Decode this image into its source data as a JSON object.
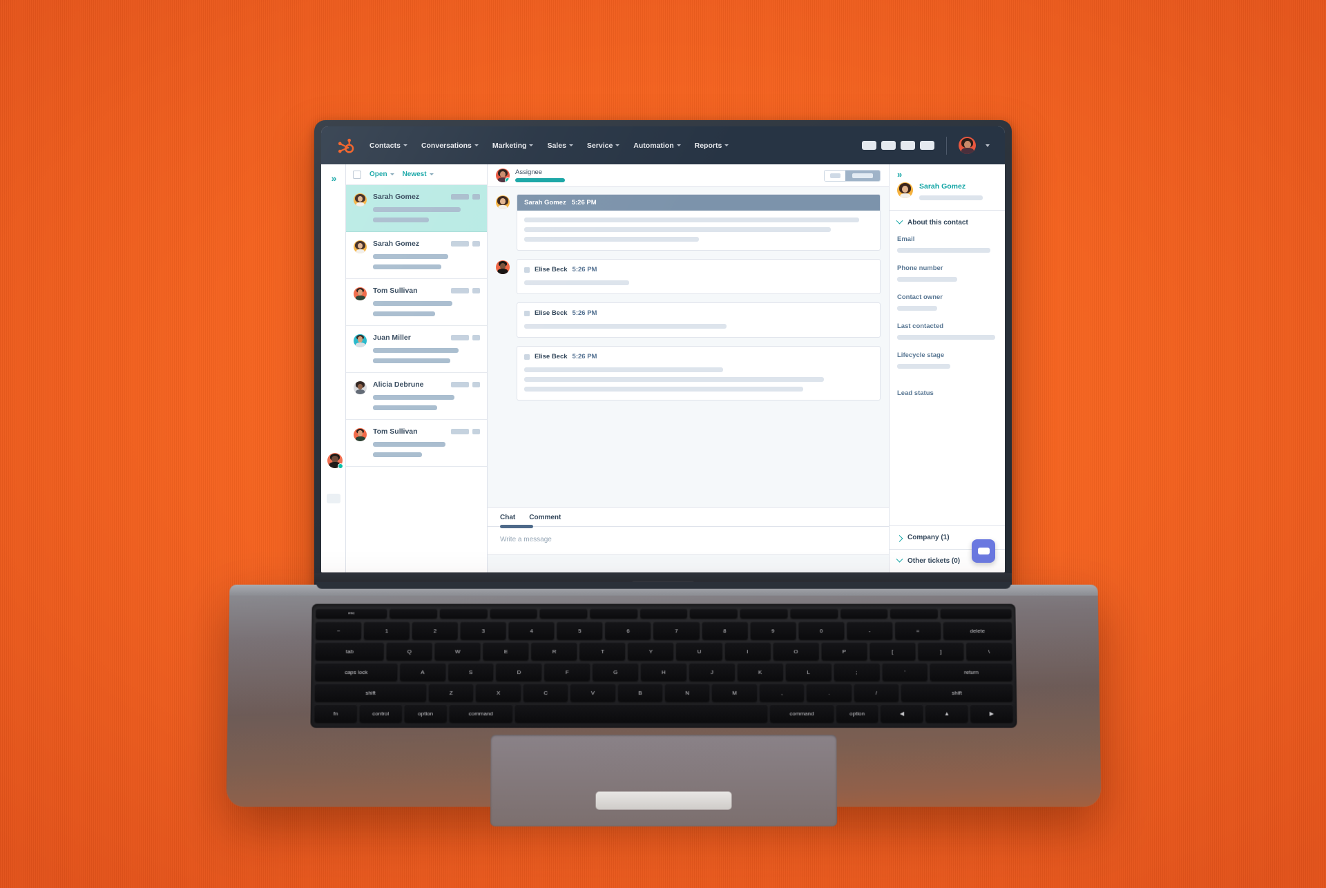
{
  "brand": {
    "logo_icon": "hubspot-sprocket-icon",
    "orange": "#f4621f",
    "navy": "#273444",
    "teal": "#0fa4a4",
    "accent_purple": "#6a78e0"
  },
  "topnav": {
    "items": [
      {
        "label": "Contacts",
        "caret": true
      },
      {
        "label": "Conversations",
        "caret": true
      },
      {
        "label": "Marketing",
        "caret": true
      },
      {
        "label": "Sales",
        "caret": true
      },
      {
        "label": "Service",
        "caret": true
      },
      {
        "label": "Automation",
        "caret": true
      },
      {
        "label": "Reports",
        "caret": true
      }
    ],
    "right_pills": 4,
    "avatar_icon": "user-avatar",
    "caret_icon": "chevron-down-icon"
  },
  "rail": {
    "expand_icon": "»",
    "avatar_icon": "user-avatar",
    "status": "online"
  },
  "list": {
    "checkbox_checked": false,
    "filters": [
      {
        "label": "Open"
      },
      {
        "label": "Newest"
      }
    ],
    "conversations": [
      {
        "name": "Sarah Gomez",
        "active": true
      },
      {
        "name": "Sarah Gomez",
        "active": false
      },
      {
        "name": "Tom Sullivan",
        "active": false
      },
      {
        "name": "Juan Miller",
        "active": false
      },
      {
        "name": "Alicia Debrune",
        "active": false
      },
      {
        "name": "Tom Sullivan",
        "active": false
      }
    ]
  },
  "thread": {
    "assignee_label": "Assignee",
    "messages": [
      {
        "author": "Sarah Gomez",
        "time": "5:26 PM",
        "style": "highlighted",
        "lines": 3
      },
      {
        "author": "Elise Beck",
        "time": "5:26 PM",
        "style": "plain",
        "lines": 1
      },
      {
        "author": "Elise Beck",
        "time": "5:26 PM",
        "style": "plain",
        "lines": 1
      },
      {
        "author": "Elise Beck",
        "time": "5:26 PM",
        "style": "plain",
        "lines": 3
      }
    ],
    "composer": {
      "tabs": [
        {
          "label": "Chat",
          "active": true
        },
        {
          "label": "Comment",
          "active": false
        }
      ],
      "placeholder": "Write a message"
    }
  },
  "sidebar": {
    "expand_icon": "»",
    "contact_name": "Sarah Gomez",
    "about_section": {
      "title": "About this contact",
      "expanded": true,
      "chevron_icon": "chevron-down-icon"
    },
    "properties": [
      {
        "label": "Email"
      },
      {
        "label": "Phone number"
      },
      {
        "label": "Contact owner"
      },
      {
        "label": "Last contacted"
      },
      {
        "label": "Lifecycle stage"
      },
      {
        "label": "Lead status"
      }
    ],
    "sections": [
      {
        "title": "Company (1)",
        "expanded": false,
        "chevron_icon": "chevron-right-icon"
      },
      {
        "title": "Other tickets (0)",
        "expanded": true,
        "chevron_icon": "chevron-down-icon"
      }
    ],
    "fab_icon": "chat-bubble-icon"
  },
  "keyboard": {
    "row_fn": [
      "esc",
      "",
      "",
      "",
      "",
      "",
      "",
      "",
      "",
      "",
      "",
      "",
      ""
    ],
    "row1": [
      "~",
      "1",
      "2",
      "3",
      "4",
      "5",
      "6",
      "7",
      "8",
      "9",
      "0",
      "-",
      "=",
      "delete"
    ],
    "row2": [
      "tab",
      "Q",
      "W",
      "E",
      "R",
      "T",
      "Y",
      "U",
      "I",
      "O",
      "P",
      "[",
      "]",
      "\\"
    ],
    "row3": [
      "caps lock",
      "A",
      "S",
      "D",
      "F",
      "G",
      "H",
      "J",
      "K",
      "L",
      ";",
      "'",
      "return"
    ],
    "row4": [
      "shift",
      "Z",
      "X",
      "C",
      "V",
      "B",
      "N",
      "M",
      ",",
      ".",
      "/",
      "shift"
    ],
    "row5": [
      "fn",
      "control",
      "option",
      "command",
      "",
      "command",
      "option",
      "◀",
      "▲",
      "▶"
    ]
  }
}
